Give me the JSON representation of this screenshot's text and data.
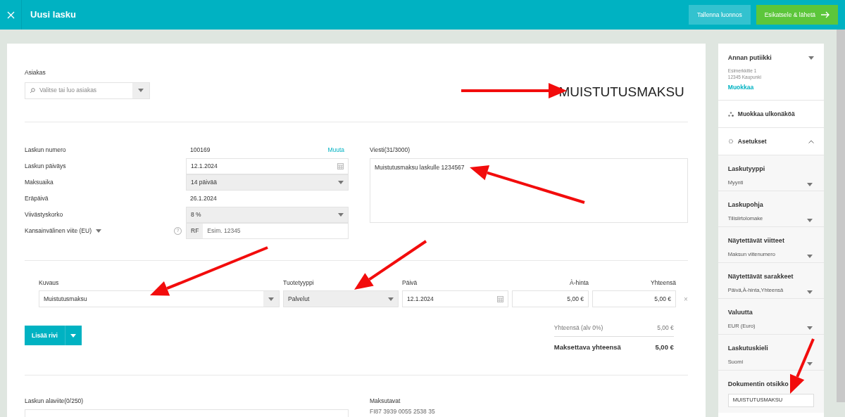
{
  "header": {
    "title": "Uusi lasku",
    "buttons": [
      {
        "label": "Tallenna luonnos",
        "kind": "secondary"
      },
      {
        "label": "Esikatsele & lähetä",
        "kind": "primary"
      }
    ]
  },
  "customer": {
    "label": "Asiakas",
    "placeholder": "Valitse tai luo asiakas"
  },
  "document_title": "MUISTUTUSMAKSU",
  "invoice_fields": [
    {
      "label": "Laskun numero",
      "kind": "text",
      "value": "100169",
      "link": "Muuta"
    },
    {
      "label": "Laskun päiväys",
      "kind": "date",
      "value": "12.1.2024"
    },
    {
      "label": "Maksuaika",
      "kind": "select",
      "value": "14 päivää"
    },
    {
      "label": "Eräpäivä",
      "kind": "text",
      "value": "26.1.2024"
    },
    {
      "label": "Viivästyskorko",
      "kind": "select",
      "value": "8 %"
    },
    {
      "label": "Kansainvälinen viite (EU)",
      "kind": "reference",
      "help": "?",
      "prefix": "RF",
      "placeholder": "Esim. 12345"
    }
  ],
  "message": {
    "label": "Viesti(31/3000)",
    "value": "Muistutusmaksu laskulle 1234567"
  },
  "line_items": {
    "columns": [
      "Kuvaus",
      "Tuotetyyppi",
      "Päivä",
      "À-hinta",
      "Yhteensä"
    ],
    "rows": [
      {
        "description": "Muistutusmaksu",
        "product_type": "Palvelut",
        "date": "12.1.2024",
        "unit_price": "5,00 €",
        "total": "5,00 €",
        "remove": "×"
      }
    ]
  },
  "add_row_button": "Lisää rivi",
  "totals": [
    {
      "label": "Yhteensä (alv 0%)",
      "value": "5,00 €",
      "kind": "subtotal"
    },
    {
      "label": "Maksettava yhteensä",
      "value": "5,00 €",
      "kind": "grand"
    }
  ],
  "footer_note": {
    "label": "Laskun alaviite(0/250)"
  },
  "payment_methods": {
    "label": "Maksutavat",
    "value": "FI87 3939 0055 2538 35"
  },
  "sidebar": {
    "company": {
      "name": "Annan putiikki",
      "address_lines": [
        "Esimerkkitie 1",
        "12345 Kaupunki"
      ],
      "edit_link": "Muokkaa"
    },
    "appearance_link": "Muokkaa ulkonäköä",
    "settings": {
      "label": "Asetukset",
      "expanded": true
    },
    "settings_items": [
      {
        "label": "Laskutyyppi",
        "value": "Myynti",
        "kind": "select"
      },
      {
        "label": "Laskupohja",
        "value": "Tilisiirtolomake",
        "kind": "select"
      },
      {
        "label": "Näytettävät viitteet",
        "value": "Maksun viitenumero",
        "kind": "select"
      },
      {
        "label": "Näytettävät sarakkeet",
        "value": "Päivä,À-hinta,Yhteensä",
        "kind": "select"
      },
      {
        "label": "Valuutta",
        "value": "EUR (Euro)",
        "kind": "select"
      },
      {
        "label": "Laskutuskieli",
        "value": "Suomi",
        "kind": "select"
      },
      {
        "label": "Dokumentin otsikko",
        "value": "MUISTUTUSMAKSU",
        "kind": "input"
      }
    ]
  },
  "annotation_arrows": [
    {
      "kind": "arrow"
    },
    {
      "kind": "arrow"
    },
    {
      "kind": "arrow"
    },
    {
      "kind": "arrow"
    },
    {
      "kind": "arrow"
    }
  ]
}
